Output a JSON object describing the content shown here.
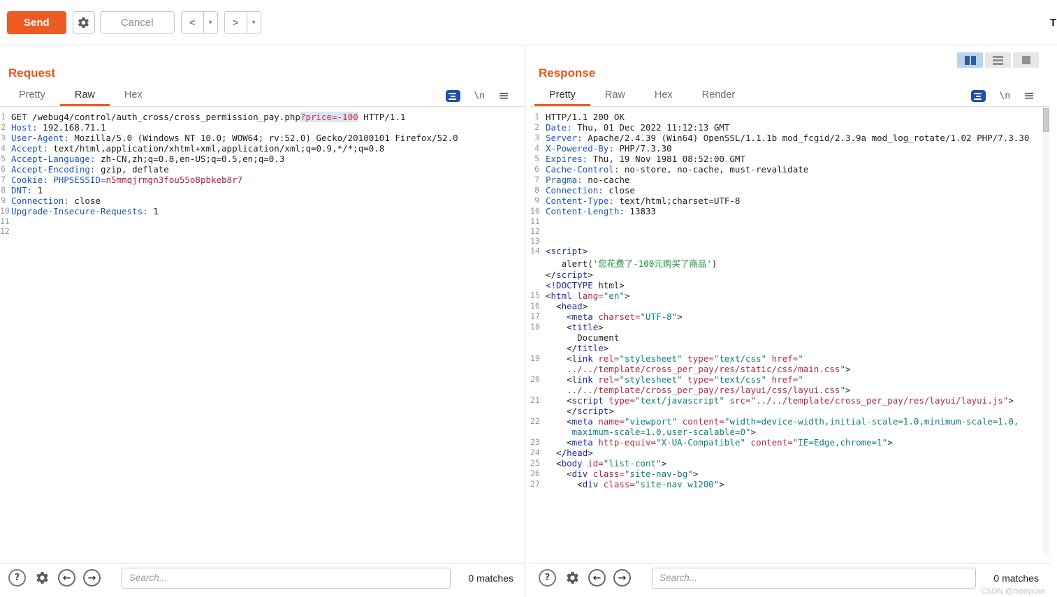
{
  "toolbar": {
    "send_label": "Send",
    "cancel_label": "Cancel",
    "back_label": "<",
    "forward_label": ">",
    "target_partial": "T"
  },
  "icons": {
    "menu": "≡",
    "caret": "▾",
    "help": "?",
    "back_arrow": "←",
    "forward_arrow": "→",
    "newline": "\\n"
  },
  "colors": {
    "accent_orange": "#ee5b22",
    "header_blue": "#1a56b8",
    "param_red": "#e0281e",
    "tag_navy": "#1f2d9b",
    "attr_maroon": "#ab2a3e",
    "value_teal": "#0e7c7b",
    "string_green": "#168c3a"
  },
  "request": {
    "title": "Request",
    "tabs": [
      "Pretty",
      "Raw",
      "Hex"
    ],
    "active_tab": "Raw",
    "search": {
      "placeholder": "Search...",
      "matches": "0 matches"
    },
    "code": [
      {
        "n": "1",
        "seg": [
          [
            "GET /webug4/control/auth_cross/cross_permission_pay.php",
            "p"
          ],
          [
            "?price=-100",
            "red"
          ],
          [
            " HTTP/1.1",
            "p"
          ]
        ]
      },
      {
        "n": "2",
        "seg": [
          [
            "Host:",
            "h"
          ],
          [
            " 192.168.71.1",
            "p"
          ]
        ]
      },
      {
        "n": "3",
        "seg": [
          [
            "User-Agent:",
            "h"
          ],
          [
            " Mozilla/5.0 (Windows NT 10.0; WOW64; rv:52.0) Gecko/20100101 Firefox/52.0",
            "p"
          ]
        ]
      },
      {
        "n": "4",
        "seg": [
          [
            "Accept:",
            "h"
          ],
          [
            " text/html,application/xhtml+xml,application/xml;q=0.9,*/*;q=0.8",
            "p"
          ]
        ]
      },
      {
        "n": "5",
        "seg": [
          [
            "Accept-Language:",
            "h"
          ],
          [
            " zh-CN,zh;q=0.8,en-US;q=0.5,en;q=0.3",
            "p"
          ]
        ]
      },
      {
        "n": "6",
        "seg": [
          [
            "Accept-Encoding:",
            "h"
          ],
          [
            " gzip, deflate",
            "p"
          ]
        ]
      },
      {
        "n": "7",
        "seg": [
          [
            "Cookie:",
            "h"
          ],
          [
            " ",
            "p"
          ],
          [
            "PHPSESSID",
            "h"
          ],
          [
            "=n5mmqjrmgn3fou55o8pbkeb8r7",
            "mar"
          ]
        ]
      },
      {
        "n": "8",
        "seg": [
          [
            "DNT:",
            "h"
          ],
          [
            " 1",
            "p"
          ]
        ]
      },
      {
        "n": "9",
        "seg": [
          [
            "Connection:",
            "h"
          ],
          [
            " close",
            "p"
          ]
        ]
      },
      {
        "n": "10",
        "seg": [
          [
            "Upgrade-Insecure-Requests:",
            "h"
          ],
          [
            " 1",
            "p"
          ]
        ]
      },
      {
        "n": "11",
        "seg": []
      },
      {
        "n": "12",
        "seg": []
      }
    ]
  },
  "response": {
    "title": "Response",
    "tabs": [
      "Pretty",
      "Raw",
      "Hex",
      "Render"
    ],
    "active_tab": "Pretty",
    "search": {
      "placeholder": "Search...",
      "matches": "0 matches"
    },
    "code": [
      {
        "n": "1",
        "seg": [
          [
            "HTTP/1.1 200 OK",
            "p"
          ]
        ]
      },
      {
        "n": "2",
        "seg": [
          [
            "Date:",
            "h"
          ],
          [
            " Thu, 01 Dec 2022 11:12:13 GMT",
            "p"
          ]
        ]
      },
      {
        "n": "3",
        "seg": [
          [
            "Server:",
            "h"
          ],
          [
            " Apache/2.4.39 (Win64) OpenSSL/1.1.1b mod_fcgid/2.3.9a mod_log_rotate/1.02 PHP/7.3.30",
            "p"
          ]
        ]
      },
      {
        "n": "4",
        "seg": [
          [
            "X-Powered-By:",
            "h"
          ],
          [
            " PHP/7.3.30",
            "p"
          ]
        ]
      },
      {
        "n": "5",
        "seg": [
          [
            "Expires:",
            "h"
          ],
          [
            " Thu, 19 Nov 1981 08:52:00 GMT",
            "p"
          ]
        ]
      },
      {
        "n": "6",
        "seg": [
          [
            "Cache-Control:",
            "h"
          ],
          [
            " no-store, no-cache, must-revalidate",
            "p"
          ]
        ]
      },
      {
        "n": "7",
        "seg": [
          [
            "Pragma:",
            "h"
          ],
          [
            " no-cache",
            "p"
          ]
        ]
      },
      {
        "n": "8",
        "seg": [
          [
            "Connection:",
            "h"
          ],
          [
            " close",
            "p"
          ]
        ]
      },
      {
        "n": "9",
        "seg": [
          [
            "Content-Type:",
            "h"
          ],
          [
            " text/html;charset=UTF-8",
            "p"
          ]
        ]
      },
      {
        "n": "10",
        "seg": [
          [
            "Content-Length:",
            "h"
          ],
          [
            " 13833",
            "p"
          ]
        ]
      },
      {
        "n": "11",
        "seg": []
      },
      {
        "n": "12",
        "seg": []
      },
      {
        "n": "13",
        "seg": []
      },
      {
        "n": "14",
        "seg": [
          [
            "<",
            "p"
          ],
          [
            "script",
            "tag"
          ],
          [
            ">",
            "p"
          ]
        ]
      },
      {
        "n": "",
        "seg": [
          [
            "   alert(",
            "p"
          ],
          [
            "'您花费了-100元购买了商品'",
            "str"
          ],
          [
            ")",
            "p"
          ]
        ]
      },
      {
        "n": "",
        "seg": [
          [
            "</",
            "p"
          ],
          [
            "script",
            "tag"
          ],
          [
            ">",
            "p"
          ]
        ]
      },
      {
        "n": "",
        "seg": [
          [
            "<!DOCTYPE",
            "tag"
          ],
          [
            " html>",
            "p"
          ]
        ]
      },
      {
        "n": "15",
        "seg": [
          [
            "<",
            "p"
          ],
          [
            "html",
            "tag"
          ],
          [
            " ",
            "p"
          ],
          [
            "lang=",
            "attr"
          ],
          [
            "\"en\"",
            "val"
          ],
          [
            ">",
            "p"
          ]
        ]
      },
      {
        "n": "16",
        "seg": [
          [
            "  <",
            "p"
          ],
          [
            "head",
            "tag"
          ],
          [
            ">",
            "p"
          ]
        ]
      },
      {
        "n": "17",
        "seg": [
          [
            "    <",
            "p"
          ],
          [
            "meta",
            "tag"
          ],
          [
            " ",
            "p"
          ],
          [
            "charset=",
            "attr"
          ],
          [
            "\"UTF-8\"",
            "val"
          ],
          [
            ">",
            "p"
          ]
        ]
      },
      {
        "n": "18",
        "seg": [
          [
            "    <",
            "p"
          ],
          [
            "title",
            "tag"
          ],
          [
            ">",
            "p"
          ]
        ]
      },
      {
        "n": "",
        "seg": [
          [
            "      Document",
            "p"
          ]
        ]
      },
      {
        "n": "",
        "seg": [
          [
            "    </",
            "p"
          ],
          [
            "title",
            "tag"
          ],
          [
            ">",
            "p"
          ]
        ]
      },
      {
        "n": "19",
        "seg": [
          [
            "    <",
            "p"
          ],
          [
            "link",
            "tag"
          ],
          [
            " ",
            "p"
          ],
          [
            "rel=",
            "attr"
          ],
          [
            "\"stylesheet\"",
            "val"
          ],
          [
            " ",
            "p"
          ],
          [
            "type=",
            "attr"
          ],
          [
            "\"text/css\"",
            "val"
          ],
          [
            " ",
            "p"
          ],
          [
            "href=",
            "attr"
          ],
          [
            "\"",
            "val"
          ]
        ]
      },
      {
        "n": "",
        "seg": [
          [
            "    ../../template/cross_per_pay/res/static/css/main.css",
            "url"
          ],
          [
            "\"",
            "val"
          ],
          [
            ">",
            "p"
          ]
        ]
      },
      {
        "n": "20",
        "seg": [
          [
            "    <",
            "p"
          ],
          [
            "link",
            "tag"
          ],
          [
            " ",
            "p"
          ],
          [
            "rel=",
            "attr"
          ],
          [
            "\"stylesheet\"",
            "val"
          ],
          [
            " ",
            "p"
          ],
          [
            "type=",
            "attr"
          ],
          [
            "\"text/css\"",
            "val"
          ],
          [
            " ",
            "p"
          ],
          [
            "href=",
            "attr"
          ],
          [
            "\"",
            "val"
          ]
        ]
      },
      {
        "n": "",
        "seg": [
          [
            "    ../../template/cross_per_pay/res/layui/css/layui.css",
            "url"
          ],
          [
            "\"",
            "val"
          ],
          [
            ">",
            "p"
          ]
        ]
      },
      {
        "n": "21",
        "seg": [
          [
            "    <",
            "p"
          ],
          [
            "script",
            "tag"
          ],
          [
            " ",
            "p"
          ],
          [
            "type=",
            "attr"
          ],
          [
            "\"text/javascript\"",
            "val"
          ],
          [
            " ",
            "p"
          ],
          [
            "src=",
            "attr"
          ],
          [
            "\"../../template/cross_per_pay/res/layui/layui.js\"",
            "url"
          ],
          [
            ">",
            "p"
          ]
        ]
      },
      {
        "n": "",
        "seg": [
          [
            "    </",
            "p"
          ],
          [
            "script",
            "tag"
          ],
          [
            ">",
            "p"
          ]
        ]
      },
      {
        "n": "22",
        "seg": [
          [
            "    <",
            "p"
          ],
          [
            "meta",
            "tag"
          ],
          [
            " ",
            "p"
          ],
          [
            "name=",
            "attr"
          ],
          [
            "\"viewport\"",
            "val"
          ],
          [
            " ",
            "p"
          ],
          [
            "content=",
            "attr"
          ],
          [
            "\"width=device-width,initial-scale=1.0,minimum-scale=1.0,",
            "val"
          ]
        ]
      },
      {
        "n": "",
        "seg": [
          [
            "     maximum-scale=1.0,user-scalable=0\"",
            "val"
          ],
          [
            ">",
            "p"
          ]
        ]
      },
      {
        "n": "23",
        "seg": [
          [
            "    <",
            "p"
          ],
          [
            "meta",
            "tag"
          ],
          [
            " ",
            "p"
          ],
          [
            "http-equiv=",
            "attr"
          ],
          [
            "\"X-UA-Compatible\"",
            "val"
          ],
          [
            " ",
            "p"
          ],
          [
            "content=",
            "attr"
          ],
          [
            "\"IE=Edge,chrome=1\"",
            "val"
          ],
          [
            ">",
            "p"
          ]
        ]
      },
      {
        "n": "24",
        "seg": [
          [
            "  </",
            "p"
          ],
          [
            "head",
            "tag"
          ],
          [
            ">",
            "p"
          ]
        ]
      },
      {
        "n": "25",
        "seg": [
          [
            "  <",
            "p"
          ],
          [
            "body",
            "tag"
          ],
          [
            " ",
            "p"
          ],
          [
            "id=",
            "attr"
          ],
          [
            "\"list-cont\"",
            "val"
          ],
          [
            ">",
            "p"
          ]
        ]
      },
      {
        "n": "26",
        "seg": [
          [
            "    <",
            "p"
          ],
          [
            "div",
            "tag"
          ],
          [
            " ",
            "p"
          ],
          [
            "class=",
            "attr"
          ],
          [
            "\"site-nav-bg\"",
            "val"
          ],
          [
            ">",
            "p"
          ]
        ]
      },
      {
        "n": "27",
        "seg": [
          [
            "      <",
            "p"
          ],
          [
            "div",
            "tag"
          ],
          [
            " ",
            "p"
          ],
          [
            "class=",
            "attr"
          ],
          [
            "\"site-nav w1200\"",
            "val"
          ],
          [
            ">",
            "p"
          ]
        ]
      }
    ]
  },
  "watermark": "CSDN @mooyuan"
}
